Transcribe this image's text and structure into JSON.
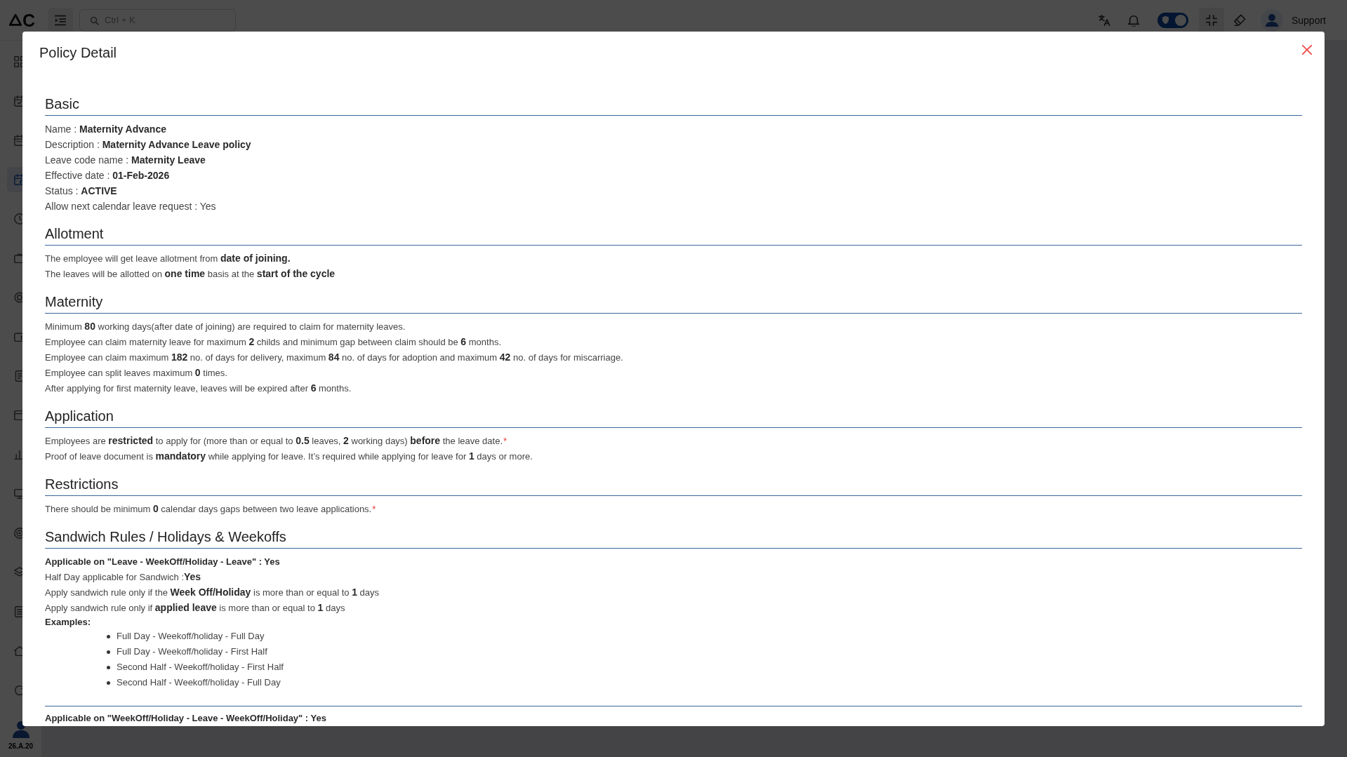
{
  "topbar": {
    "logo": "C",
    "search": {
      "placeholder": "Ctrl + K"
    },
    "privacy_toggle": {
      "on": true
    },
    "user": {
      "name": "Support"
    }
  },
  "sidebar": {
    "items": [
      {
        "selected": false
      },
      {
        "selected": false
      },
      {
        "selected": false
      },
      {
        "selected": true
      },
      {
        "selected": false
      },
      {
        "selected": false
      },
      {
        "selected": false
      },
      {
        "selected": false
      },
      {
        "selected": false
      },
      {
        "selected": false
      },
      {
        "selected": false
      },
      {
        "selected": false
      },
      {
        "selected": false
      },
      {
        "selected": false
      },
      {
        "selected": false
      },
      {
        "selected": false
      },
      {
        "selected": false
      }
    ],
    "version": "26.A.20"
  },
  "modal": {
    "title": "Policy Detail",
    "sections": [
      {
        "title": "Basic",
        "kind": "details",
        "lines": [
          {
            "kind": "text",
            "text": "Name : **Maternity Advance**"
          },
          {
            "kind": "text",
            "text": "Description : **Maternity Advance Leave policy**"
          },
          {
            "kind": "text",
            "text": "Leave code name : **Maternity Leave**"
          },
          {
            "kind": "text",
            "text": "Effective date : **01-Feb-2026**"
          },
          {
            "kind": "text",
            "text": "Status : **ACTIVE**"
          },
          {
            "kind": "text",
            "text": "Allow next calendar leave request : Yes"
          }
        ]
      },
      {
        "title": "Allotment",
        "kind": "rules",
        "lines": [
          {
            "kind": "text",
            "text": "The employee will get leave allotment from **date of joining.**"
          },
          {
            "kind": "text",
            "text": "The leaves will be allotted on **one time** basis at the **start of the cycle**"
          }
        ]
      },
      {
        "title": "Maternity",
        "kind": "rules",
        "lines": [
          {
            "kind": "text",
            "text": "Minimum **80** working days(after date of joining) are required to claim for maternity leaves."
          },
          {
            "kind": "text",
            "text": "Employee can claim maternity leave for maximum **2** childs and minimum gap between claim should be **6** months."
          },
          {
            "kind": "text",
            "text": "Employee can claim maximum **182** no. of days for delivery, maximum **84** no. of days for adoption and maximum **42** no. of days for miscarriage."
          },
          {
            "kind": "text",
            "text": "Employee can split leaves maximum **0** times."
          },
          {
            "kind": "text",
            "text": "After applying for first maternity leave, leaves will be expired after **6** months."
          }
        ]
      },
      {
        "title": "Application",
        "kind": "rules",
        "lines": [
          {
            "kind": "text",
            "text": "Employees are **restricted** to apply for (more than or equal to **0.5** leaves, **2** working days) **before** the leave date.",
            "mark": "*"
          },
          {
            "kind": "text",
            "text": "Proof of leave document is **mandatory** while applying for leave. It’s required while applying for leave for **1** days or more."
          }
        ]
      },
      {
        "title": "Restrictions",
        "kind": "rules",
        "lines": [
          {
            "kind": "text",
            "text": "There should be minimum **0** calendar days gaps between two leave applications.",
            "mark": "*"
          }
        ]
      },
      {
        "title": "Sandwich Rules / Holidays & Weekoffs",
        "kind": "rules",
        "lines": [
          {
            "kind": "strong",
            "text": "Applicable on \"Leave - WeekOff/Holiday - Leave\" : Yes"
          },
          {
            "kind": "text",
            "text": "Half Day applicable for Sandwich :**Yes**"
          },
          {
            "kind": "text",
            "text": "Apply sandwich rule only if the **Week Off/Holiday** is more than or equal to **1** days"
          },
          {
            "kind": "text",
            "text": "Apply sandwich rule only if **applied leave** is more than or equal to **1** days"
          },
          {
            "kind": "list",
            "label": "Examples:",
            "items": [
              "Full Day - Weekoff/holiday - Full Day",
              "Full Day - Weekoff/holiday - First Half",
              "Second Half - Weekoff/holiday - First Half",
              "Second Half - Weekoff/holiday - Full Day"
            ]
          },
          {
            "kind": "divider"
          },
          {
            "kind": "strong",
            "text": "Applicable on \"WeekOff/Holiday - Leave - WeekOff/Holiday\" : Yes"
          }
        ]
      }
    ]
  }
}
